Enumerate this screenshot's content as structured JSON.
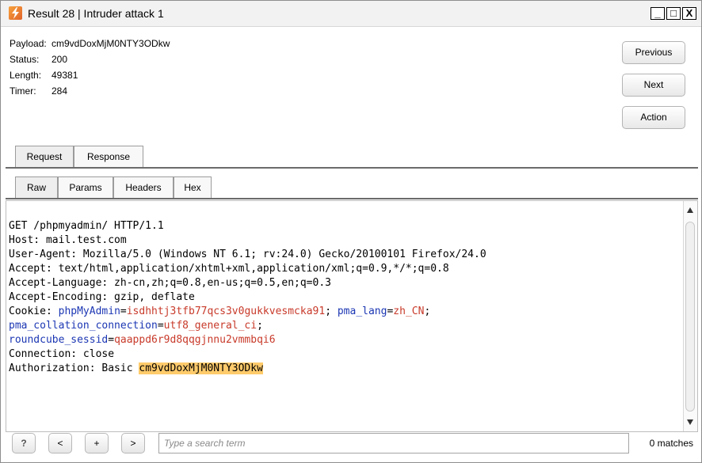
{
  "window": {
    "title": "Result 28 | Intruder attack 1",
    "controls": {
      "minimize": "_",
      "maximize": "□",
      "close": "X"
    }
  },
  "info": [
    {
      "key": "Payload:",
      "value": "cm9vdDoxMjM0NTY3ODkw"
    },
    {
      "key": "Status:",
      "value": "200"
    },
    {
      "key": "Length:",
      "value": "49381"
    },
    {
      "key": "Timer:",
      "value": "284"
    }
  ],
  "actions": {
    "previous": "Previous",
    "next": "Next",
    "action": "Action"
  },
  "main_tabs": [
    {
      "label": "Request",
      "active": true
    },
    {
      "label": "Response",
      "active": false
    }
  ],
  "sub_tabs": [
    {
      "label": "Raw",
      "active": true
    },
    {
      "label": "Params",
      "active": false
    },
    {
      "label": "Headers",
      "active": false
    },
    {
      "label": "Hex",
      "active": false
    }
  ],
  "request": {
    "line1": "GET /phpmyadmin/ HTTP/1.1",
    "line2": "Host: mail.test.com",
    "line3": "User-Agent: Mozilla/5.0 (Windows NT 6.1; rv:24.0) Gecko/20100101 Firefox/24.0",
    "line4": "Accept: text/html,application/xhtml+xml,application/xml;q=0.9,*/*;q=0.8",
    "line5": "Accept-Language: zh-cn,zh;q=0.8,en-us;q=0.5,en;q=0.3",
    "line6": "Accept-Encoding: gzip, deflate",
    "cookie_label": "Cookie: ",
    "cookie1_name": "phpMyAdmin",
    "cookie1_value": "isdhhtj3tfb77qcs3v0gukkvesmcka91",
    "cookie2_name": "pma_lang",
    "cookie2_value": "zh_CN",
    "cookie3_name": "pma_collation_connection",
    "cookie3_value": "utf8_general_ci",
    "cookie4_name": "roundcube_sessid",
    "cookie4_value": "qaappd6r9d8qqgjnnu2vmmbqi6",
    "line_conn": "Connection: close",
    "auth_label": "Authorization: Basic ",
    "auth_value": "cm9vdDoxMjM0NTY3ODkw"
  },
  "search": {
    "help": "?",
    "prev": "<",
    "add": "+",
    "next": ">",
    "placeholder": "Type a search term",
    "matches": "0 matches"
  },
  "colors": {
    "param_name": "#1c37b3",
    "param_value": "#c83a2a",
    "highlight": "#ffcb6b"
  }
}
